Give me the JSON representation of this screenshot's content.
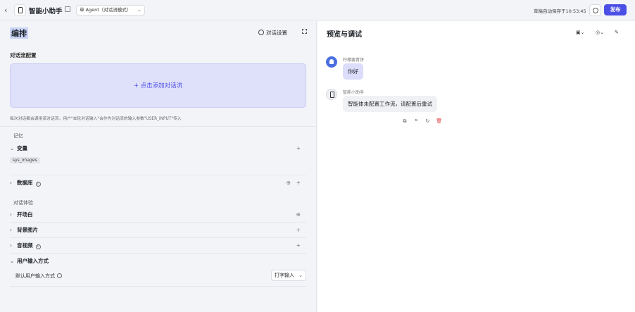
{
  "topbar": {
    "back_icon": "chevron-left-icon",
    "app_icon": "phone-icon",
    "app_title": "智能小助手",
    "edit_icon": "edit-icon",
    "mode_label": "单 Agent（对话流模式）",
    "save_status": "草稿自动保存于10:53:45",
    "history_icon": "history-icon",
    "publish_label": "发布"
  },
  "left": {
    "title": "编排",
    "dialog_settings_label": "对话设置",
    "flow_config_label": "对话流配置",
    "add_flow_label": "+ 点击添加对话流",
    "flow_note": "每次对话都会调用该对话流，用户\"本轮对话输入\"会作为对话流的输入参数\"USER_INPUT\"传入",
    "memory_section": "记忆",
    "variables_label": "变量",
    "variable_tag": "sys_images",
    "database_label": "数据库",
    "experience_section": "对话体验",
    "opening_label": "开场白",
    "background_label": "背景图片",
    "av_label": "音视频",
    "input_mode_label": "用户输入方式",
    "default_input_label": "默认用户输入方式",
    "default_input_value": "打字输入"
  },
  "right": {
    "title": "预览与调试",
    "user_name": "柠檬酱青饼",
    "user_message": "你好",
    "bot_name": "智能小助手",
    "bot_message": "智能体未配置工作流，请配置后重试",
    "message_actions": [
      "copy-icon",
      "quote-icon",
      "refresh-icon",
      "delete-icon"
    ]
  },
  "colors": {
    "accent": "#4c4fe6",
    "add_flow_bg": "#dfe1fb",
    "user_bubble": "#dcdcfb",
    "bot_bubble": "#f0f1f4",
    "delete": "#e5484d"
  }
}
